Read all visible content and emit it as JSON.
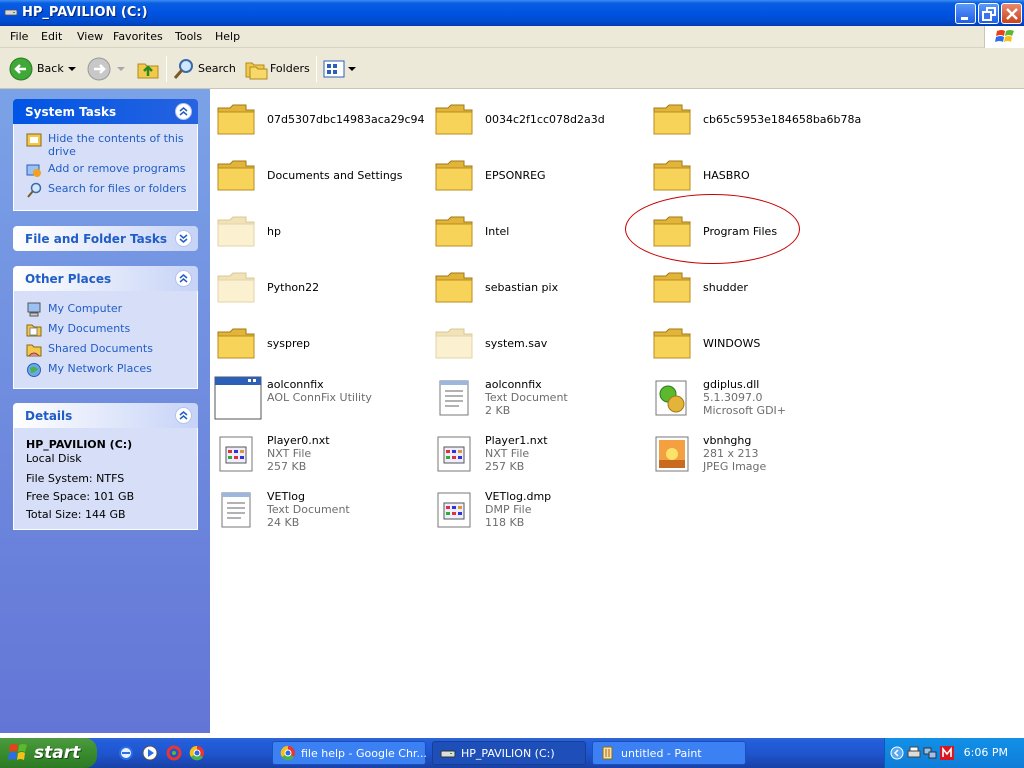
{
  "window": {
    "title": "HP_PAVILION (C:)"
  },
  "menu": [
    "File",
    "Edit",
    "View",
    "Favorites",
    "Tools",
    "Help"
  ],
  "toolbar": {
    "back": "Back",
    "search": "Search",
    "folders": "Folders"
  },
  "left_pane": {
    "system_tasks": {
      "title": "System Tasks",
      "links": [
        "Hide the contents of this drive",
        "Add or remove programs",
        "Search for files or folders"
      ]
    },
    "file_folder_tasks": {
      "title": "File and Folder Tasks"
    },
    "other_places": {
      "title": "Other Places",
      "links": [
        "My Computer",
        "My Documents",
        "Shared Documents",
        "My Network Places"
      ]
    },
    "details": {
      "title": "Details",
      "name": "HP_PAVILION (C:)",
      "type": "Local Disk",
      "file_system": "File System: NTFS",
      "free_space": "Free Space: 101 GB",
      "total_size": "Total Size: 144 GB"
    }
  },
  "items": [
    {
      "name": "07d5307dbc14983aca29c947...",
      "kind": "folder"
    },
    {
      "name": "0034c2f1cc078d2a3d",
      "kind": "folder"
    },
    {
      "name": "cb65c5953e184658ba6b78aa",
      "kind": "folder"
    },
    {
      "name": "Documents and Settings",
      "kind": "folder"
    },
    {
      "name": "EPSONREG",
      "kind": "folder"
    },
    {
      "name": "HASBRO",
      "kind": "folder"
    },
    {
      "name": "hp",
      "kind": "folder-hidden"
    },
    {
      "name": "Intel",
      "kind": "folder"
    },
    {
      "name": "Program Files",
      "kind": "folder"
    },
    {
      "name": "Python22",
      "kind": "folder-hidden"
    },
    {
      "name": "sebastian pix",
      "kind": "folder"
    },
    {
      "name": "shudder",
      "kind": "folder"
    },
    {
      "name": "sysprep",
      "kind": "folder"
    },
    {
      "name": "system.sav",
      "kind": "folder-hidden"
    },
    {
      "name": "WINDOWS",
      "kind": "folder"
    },
    {
      "name": "aolconnfix",
      "kind": "app",
      "line2": "AOL ConnFix Utility",
      "line3": ""
    },
    {
      "name": "aolconnfix",
      "kind": "text",
      "line2": "Text Document",
      "line3": "2 KB"
    },
    {
      "name": "gdiplus.dll",
      "kind": "dll",
      "line2": "5.1.3097.0",
      "line3": "Microsoft GDI+"
    },
    {
      "name": "Player0.nxt",
      "kind": "generic",
      "line2": "NXT File",
      "line3": "257 KB"
    },
    {
      "name": "Player1.nxt",
      "kind": "generic",
      "line2": "NXT File",
      "line3": "257 KB"
    },
    {
      "name": "vbnhghg",
      "kind": "image",
      "line2": "281 x 213",
      "line3": "JPEG Image"
    },
    {
      "name": "VETlog",
      "kind": "text",
      "line2": "Text Document",
      "line3": "24 KB"
    },
    {
      "name": "VETlog.dmp",
      "kind": "generic",
      "line2": "DMP File",
      "line3": "118 KB"
    }
  ],
  "taskbar": {
    "start": "start",
    "buttons": [
      "file help - Google Chr...",
      "HP_PAVILION (C:)",
      "untitled - Paint"
    ],
    "clock": "6:06 PM"
  }
}
